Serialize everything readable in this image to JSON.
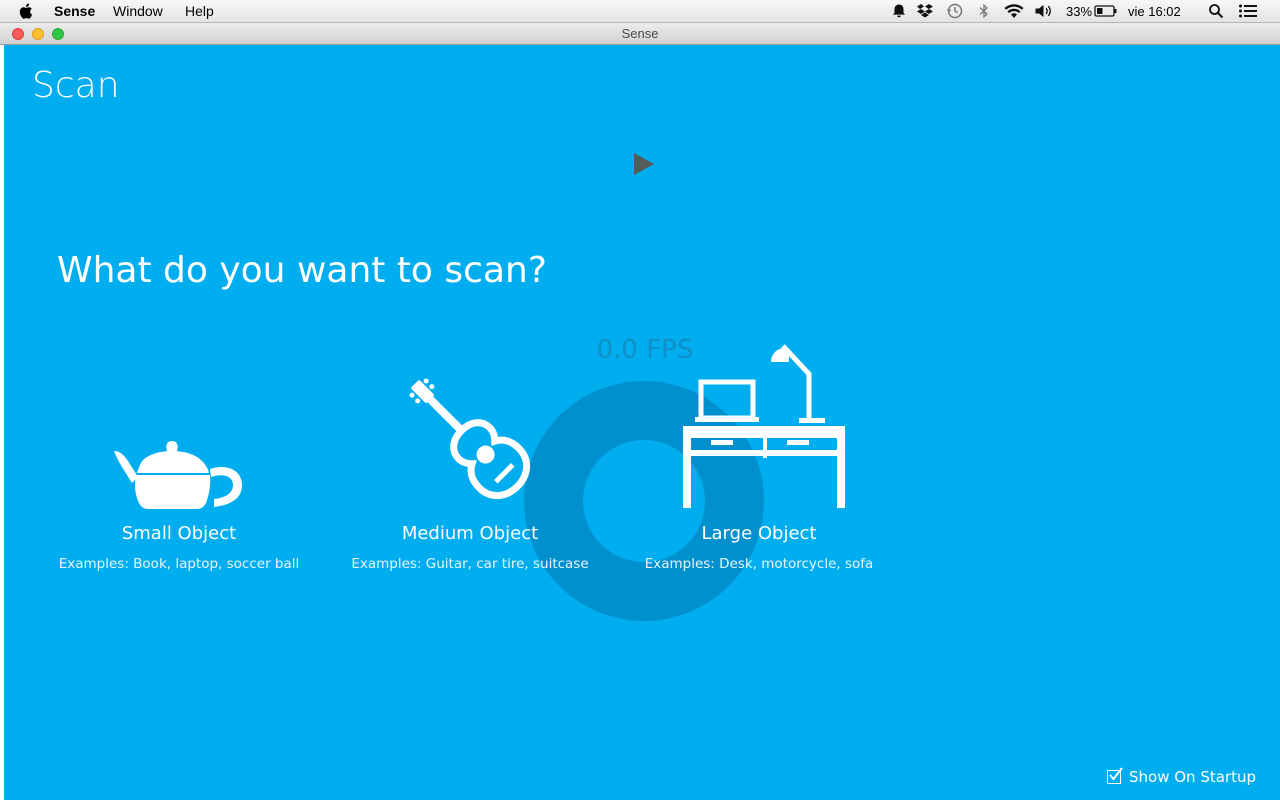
{
  "menubar": {
    "app_name": "Sense",
    "items": [
      "Window",
      "Help"
    ],
    "battery": "33%",
    "clock": "vie 16:02",
    "icons": [
      "apple-icon",
      "notifications-icon",
      "dropbox-icon",
      "time-machine-icon",
      "bluetooth-icon",
      "wifi-icon",
      "volume-icon",
      "battery-icon",
      "spotlight-icon",
      "notification-center-icon"
    ]
  },
  "window": {
    "title": "Sense"
  },
  "main": {
    "title": "Scan",
    "question": "What do you want to scan?",
    "fps": "0.0 FPS",
    "options": [
      {
        "label": "Small Object",
        "examples": "Examples: Book, laptop, soccer ball",
        "icon": "teapot-icon"
      },
      {
        "label": "Medium Object",
        "examples": "Examples: Guitar, car tire, suitcase",
        "icon": "guitar-icon"
      },
      {
        "label": "Large Object",
        "examples": "Examples: Desk, motorcycle, sofa",
        "icon": "desk-icon"
      }
    ],
    "show_on_startup": {
      "label": "Show On Startup",
      "checked": true
    }
  },
  "colors": {
    "background": "#00adef",
    "spinner": "#0090cd",
    "fps_text": "#0f8ec7"
  }
}
